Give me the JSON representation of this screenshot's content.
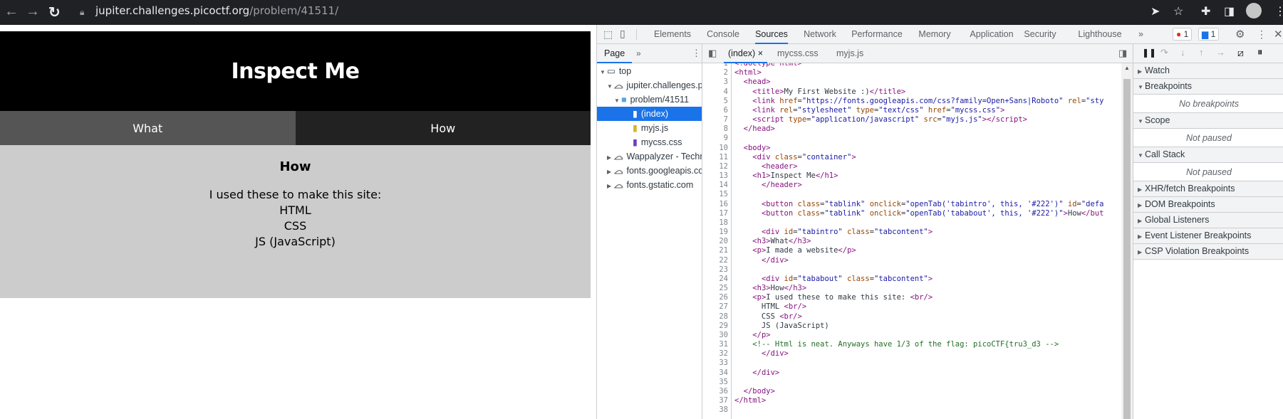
{
  "browser": {
    "url_host": "jupiter.challenges.picoctf.org",
    "url_path": "/problem/41511/",
    "icons": [
      "back-icon",
      "forward-icon",
      "reload-icon",
      "lock-icon",
      "send-icon",
      "star-icon",
      "extensions-icon",
      "side-panel-icon",
      "avatar-icon",
      "menu-icon"
    ]
  },
  "site": {
    "title": "Inspect Me",
    "tabs": [
      {
        "label": "What"
      },
      {
        "label": "How"
      }
    ],
    "heading": "How",
    "lines": [
      "I used these to make this site:",
      "HTML",
      "CSS",
      "JS (JavaScript)"
    ],
    "colors": {
      "header": "#000000",
      "tab_active": "#555555",
      "tab_inactive": "#222222",
      "content": "#cccccc"
    }
  },
  "devtools": {
    "tabs": [
      "Elements",
      "Console",
      "Sources",
      "Network",
      "Performance",
      "Memory",
      "Application",
      "Security",
      "Lighthouse"
    ],
    "active_tab": "Sources",
    "more": "»",
    "error_count": "1",
    "message_count": "1",
    "navigator_tab": "Page",
    "tree": [
      {
        "label": "top",
        "icon": "frame-icon",
        "open": true
      },
      {
        "label": "jupiter.challenges.picoctf.org",
        "icon": "cloud-icon",
        "open": true
      },
      {
        "label": "problem/41511",
        "icon": "folder-icon",
        "open": true
      },
      {
        "label": "(index)",
        "icon": "file-icon",
        "selected": true
      },
      {
        "label": "myjs.js",
        "icon": "js-file-icon"
      },
      {
        "label": "mycss.css",
        "icon": "css-file-icon"
      },
      {
        "label": "Wappalyzer - Technology profiler",
        "icon": "cloud-icon",
        "open": false
      },
      {
        "label": "fonts.googleapis.com",
        "icon": "cloud-icon",
        "open": false
      },
      {
        "label": "fonts.gstatic.com",
        "icon": "cloud-icon",
        "open": false
      }
    ],
    "editor_tabs": [
      {
        "label": "(index)",
        "active": true,
        "close": "×"
      },
      {
        "label": "mycss.css"
      },
      {
        "label": "myjs.js"
      }
    ],
    "code": [
      [
        [
          "tag",
          "<!doctype html>"
        ]
      ],
      [
        [
          "tag",
          "<html>"
        ]
      ],
      [
        [
          "txt",
          "  "
        ],
        [
          "tag",
          "<head>"
        ]
      ],
      [
        [
          "txt",
          "    "
        ],
        [
          "tag",
          "<title>"
        ],
        [
          "txt",
          "My First Website :)"
        ],
        [
          "tag",
          "</title>"
        ]
      ],
      [
        [
          "txt",
          "    "
        ],
        [
          "tag",
          "<link "
        ],
        [
          "attr",
          "href"
        ],
        [
          "txt",
          "="
        ],
        [
          "val",
          "\"https://fonts.googleapis.com/css?family=Open+Sans|Roboto\""
        ],
        [
          "txt",
          " "
        ],
        [
          "attr",
          "rel"
        ],
        [
          "txt",
          "="
        ],
        [
          "val",
          "\"sty"
        ]
      ],
      [
        [
          "txt",
          "    "
        ],
        [
          "tag",
          "<link "
        ],
        [
          "attr",
          "rel"
        ],
        [
          "txt",
          "="
        ],
        [
          "val",
          "\"stylesheet\""
        ],
        [
          "txt",
          " "
        ],
        [
          "attr",
          "type"
        ],
        [
          "txt",
          "="
        ],
        [
          "val",
          "\"text/css\""
        ],
        [
          "txt",
          " "
        ],
        [
          "attr",
          "href"
        ],
        [
          "txt",
          "="
        ],
        [
          "val",
          "\"mycss.css\""
        ],
        [
          "tag",
          ">"
        ]
      ],
      [
        [
          "txt",
          "    "
        ],
        [
          "tag",
          "<script "
        ],
        [
          "attr",
          "type"
        ],
        [
          "txt",
          "="
        ],
        [
          "val",
          "\"application/javascript\""
        ],
        [
          "txt",
          " "
        ],
        [
          "attr",
          "src"
        ],
        [
          "txt",
          "="
        ],
        [
          "val",
          "\"myjs.js\""
        ],
        [
          "tag",
          "></script>"
        ]
      ],
      [
        [
          "txt",
          "  "
        ],
        [
          "tag",
          "</head>"
        ]
      ],
      [],
      [
        [
          "txt",
          "  "
        ],
        [
          "tag",
          "<body>"
        ]
      ],
      [
        [
          "txt",
          "    "
        ],
        [
          "tag",
          "<div "
        ],
        [
          "attr",
          "class"
        ],
        [
          "txt",
          "="
        ],
        [
          "val",
          "\"container\""
        ],
        [
          "tag",
          ">"
        ]
      ],
      [
        [
          "txt",
          "      "
        ],
        [
          "tag",
          "<header>"
        ]
      ],
      [
        [
          "txt",
          "    "
        ],
        [
          "tag",
          "<h1>"
        ],
        [
          "txt",
          "Inspect Me"
        ],
        [
          "tag",
          "</h1>"
        ]
      ],
      [
        [
          "txt",
          "      "
        ],
        [
          "tag",
          "</header>"
        ]
      ],
      [],
      [
        [
          "txt",
          "      "
        ],
        [
          "tag",
          "<button "
        ],
        [
          "attr",
          "class"
        ],
        [
          "txt",
          "="
        ],
        [
          "val",
          "\"tablink\""
        ],
        [
          "txt",
          " "
        ],
        [
          "attr",
          "onclick"
        ],
        [
          "txt",
          "="
        ],
        [
          "val",
          "\"openTab('tabintro', this, '#222')\""
        ],
        [
          "txt",
          " "
        ],
        [
          "attr",
          "id"
        ],
        [
          "txt",
          "="
        ],
        [
          "val",
          "\"defa"
        ]
      ],
      [
        [
          "txt",
          "      "
        ],
        [
          "tag",
          "<button "
        ],
        [
          "attr",
          "class"
        ],
        [
          "txt",
          "="
        ],
        [
          "val",
          "\"tablink\""
        ],
        [
          "txt",
          " "
        ],
        [
          "attr",
          "onclick"
        ],
        [
          "txt",
          "="
        ],
        [
          "val",
          "\"openTab('tababout', this, '#222')\""
        ],
        [
          "tag",
          ">"
        ],
        [
          "txt",
          "How"
        ],
        [
          "tag",
          "</but"
        ]
      ],
      [],
      [
        [
          "txt",
          "      "
        ],
        [
          "tag",
          "<div "
        ],
        [
          "attr",
          "id"
        ],
        [
          "txt",
          "="
        ],
        [
          "val",
          "\"tabintro\""
        ],
        [
          "txt",
          " "
        ],
        [
          "attr",
          "class"
        ],
        [
          "txt",
          "="
        ],
        [
          "val",
          "\"tabcontent\""
        ],
        [
          "tag",
          ">"
        ]
      ],
      [
        [
          "txt",
          "    "
        ],
        [
          "tag",
          "<h3>"
        ],
        [
          "txt",
          "What"
        ],
        [
          "tag",
          "</h3>"
        ]
      ],
      [
        [
          "txt",
          "    "
        ],
        [
          "tag",
          "<p>"
        ],
        [
          "txt",
          "I made a website"
        ],
        [
          "tag",
          "</p>"
        ]
      ],
      [
        [
          "txt",
          "      "
        ],
        [
          "tag",
          "</div>"
        ]
      ],
      [],
      [
        [
          "txt",
          "      "
        ],
        [
          "tag",
          "<div "
        ],
        [
          "attr",
          "id"
        ],
        [
          "txt",
          "="
        ],
        [
          "val",
          "\"tababout\""
        ],
        [
          "txt",
          " "
        ],
        [
          "attr",
          "class"
        ],
        [
          "txt",
          "="
        ],
        [
          "val",
          "\"tabcontent\""
        ],
        [
          "tag",
          ">"
        ]
      ],
      [
        [
          "txt",
          "    "
        ],
        [
          "tag",
          "<h3>"
        ],
        [
          "txt",
          "How"
        ],
        [
          "tag",
          "</h3>"
        ]
      ],
      [
        [
          "txt",
          "    "
        ],
        [
          "tag",
          "<p>"
        ],
        [
          "txt",
          "I used these to make this site: "
        ],
        [
          "tag",
          "<br/>"
        ]
      ],
      [
        [
          "txt",
          "      HTML "
        ],
        [
          "tag",
          "<br/>"
        ]
      ],
      [
        [
          "txt",
          "      CSS "
        ],
        [
          "tag",
          "<br/>"
        ]
      ],
      [
        [
          "txt",
          "      JS (JavaScript)"
        ]
      ],
      [
        [
          "txt",
          "    "
        ],
        [
          "tag",
          "</p>"
        ]
      ],
      [
        [
          "txt",
          "    "
        ],
        [
          "com",
          "<!-- Html is neat. Anyways have 1/3 of the flag: picoCTF{tru3_d3 -->"
        ]
      ],
      [
        [
          "txt",
          "      "
        ],
        [
          "tag",
          "</div>"
        ]
      ],
      [],
      [
        [
          "txt",
          "    "
        ],
        [
          "tag",
          "</div>"
        ]
      ],
      [],
      [
        [
          "txt",
          "  "
        ],
        [
          "tag",
          "</body>"
        ]
      ],
      [
        [
          "tag",
          "</html>"
        ]
      ],
      []
    ],
    "debugger_sections": [
      {
        "label": "Watch",
        "open": false
      },
      {
        "label": "Breakpoints",
        "open": true,
        "body": "No breakpoints"
      },
      {
        "label": "Scope",
        "open": true,
        "body": "Not paused"
      },
      {
        "label": "Call Stack",
        "open": true,
        "body": "Not paused"
      },
      {
        "label": "XHR/fetch Breakpoints",
        "open": false
      },
      {
        "label": "DOM Breakpoints",
        "open": false
      },
      {
        "label": "Global Listeners",
        "open": false
      },
      {
        "label": "Event Listener Breakpoints",
        "open": false
      },
      {
        "label": "CSP Violation Breakpoints",
        "open": false
      }
    ]
  }
}
